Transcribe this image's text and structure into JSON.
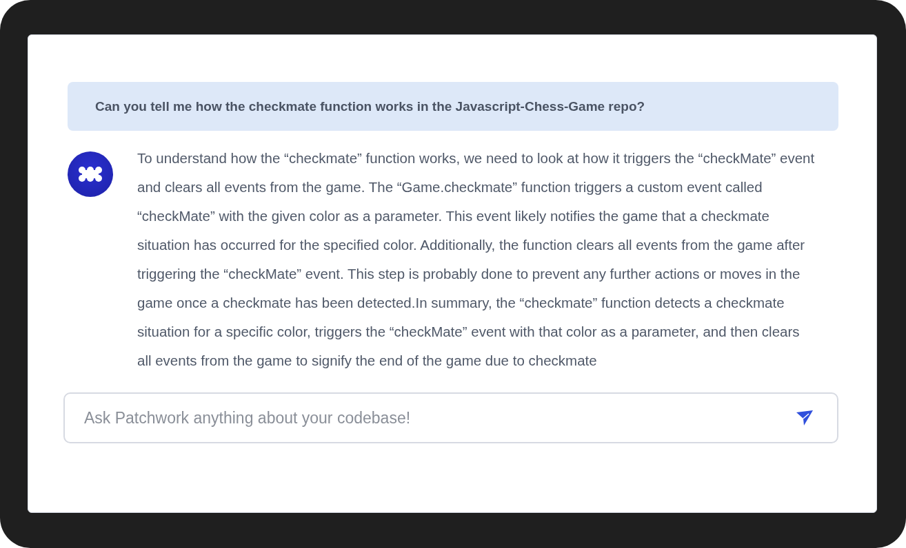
{
  "question": "Can you tell me how the checkmate function works in the Javascript-Chess-Game repo?",
  "answer": "To understand how the “checkmate” function works, we need to look at how it triggers the “checkMate” event and clears all events from the game. The “Game.checkmate” function triggers a custom event called “checkMate” with the given color as a parameter. This event likely notifies the game that a checkmate situation has occurred for the specified color. Additionally, the function clears all events from the game after triggering the “checkMate” event. This step is probably done to prevent any further actions or moves in the game once a checkmate has been detected.In summary, the “checkmate” function detects a checkmate situation for a specific color, triggers the “checkMate” event with that color as a parameter, and then clears all events from the game to signify the end of the game due to checkmate",
  "input": {
    "placeholder": "Ask Patchwork anything about your codebase!"
  }
}
